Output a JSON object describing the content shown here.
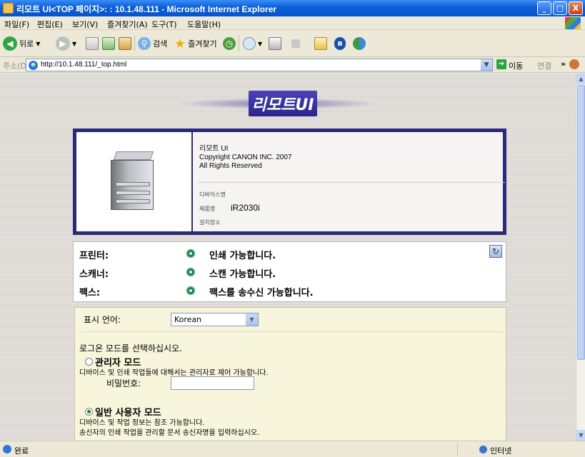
{
  "window": {
    "title": "리모트 UI<TOP 페이지>: : 10.1.48.111 - Microsoft Internet Explorer",
    "minimize": "_",
    "maximize": "□",
    "close": "X"
  },
  "menu": [
    "파일(F)",
    "편집(E)",
    "보기(V)",
    "즐겨찾기(A)",
    "도구(T)",
    "도움말(H)"
  ],
  "toolbar": {
    "back": "뒤로",
    "search": "검색",
    "favorites": "즐겨찾기"
  },
  "address": {
    "label": "주소(D)",
    "url": "http://10.1.48.111/_top.html",
    "go": "이동",
    "links": "연결",
    "more": "»"
  },
  "banner": {
    "title": "리모트UI"
  },
  "device": {
    "product": "리모트 UI",
    "copyright": "Copyright CANON INC. 2007",
    "rights": "All Rights Reserved",
    "device_name_label": "디바이스명",
    "device_name": "",
    "product_name_label": "제품명",
    "product_name": "iR2030i",
    "location_label": "설치장소"
  },
  "status": {
    "rows": [
      {
        "label": "프린터:",
        "message": "인쇄 가능합니다."
      },
      {
        "label": "스캐너:",
        "message": "스캔 가능합니다."
      },
      {
        "label": "팩스:",
        "message": "팩스를 송수신 가능합니다."
      }
    ]
  },
  "login": {
    "language_label": "표시 언어:",
    "language_value": "Korean",
    "prompt": "로그온 모드를 선택하십시오.",
    "admin_mode": "관리자 모드",
    "admin_desc": "디바이스 및 인쇄 작업들에 대해서는 관리자로 제어 가능합니다.",
    "password_label": "비밀번호:",
    "password_value": "",
    "user_mode": "일반 사용자 모드",
    "user_desc1": "디바이스 및 작업 정보는 참조 가능합니다.",
    "user_desc2": "송신자의 인쇄 작업을 관리할 문서 송신자명을 입력하십시오."
  },
  "statusbar": {
    "status": "완료",
    "zone": "인터넷"
  },
  "colors": {
    "title_bar": "#0a5fd8",
    "device_border": "#2b2a78",
    "status_ok": "#1a7a4a",
    "login_bg": "#f7f5dc"
  }
}
